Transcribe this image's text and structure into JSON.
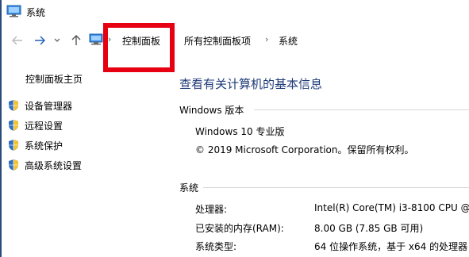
{
  "window": {
    "title": "系统"
  },
  "address": {
    "items": [
      "控制面板",
      "所有控制面板项",
      "系统"
    ]
  },
  "sidebar": {
    "home": "控制面板主页",
    "items": [
      {
        "label": "设备管理器",
        "icon": "shield-icon"
      },
      {
        "label": "远程设置",
        "icon": "shield-icon"
      },
      {
        "label": "系统保护",
        "icon": "shield-icon"
      },
      {
        "label": "高级系统设置",
        "icon": "shield-icon"
      }
    ]
  },
  "main": {
    "title": "查看有关计算机的基本信息",
    "edition_section": {
      "label": "Windows 版本",
      "edition": "Windows 10 专业版",
      "copyright": "© 2019 Microsoft Corporation。保留所有权利。"
    },
    "system_section": {
      "label": "系统",
      "rows": [
        {
          "key": "处理器:",
          "value": "Intel(R) Core(TM) i3-8100 CPU @"
        },
        {
          "key": "已安装的内存(RAM):",
          "value": "8.00 GB (7.85 GB 可用)"
        },
        {
          "key": "系统类型:",
          "value": "64 位操作系统，基于 x64 的处理器"
        }
      ]
    }
  },
  "colors": {
    "highlight": "#e60012",
    "title_blue": "#1e3a78"
  }
}
